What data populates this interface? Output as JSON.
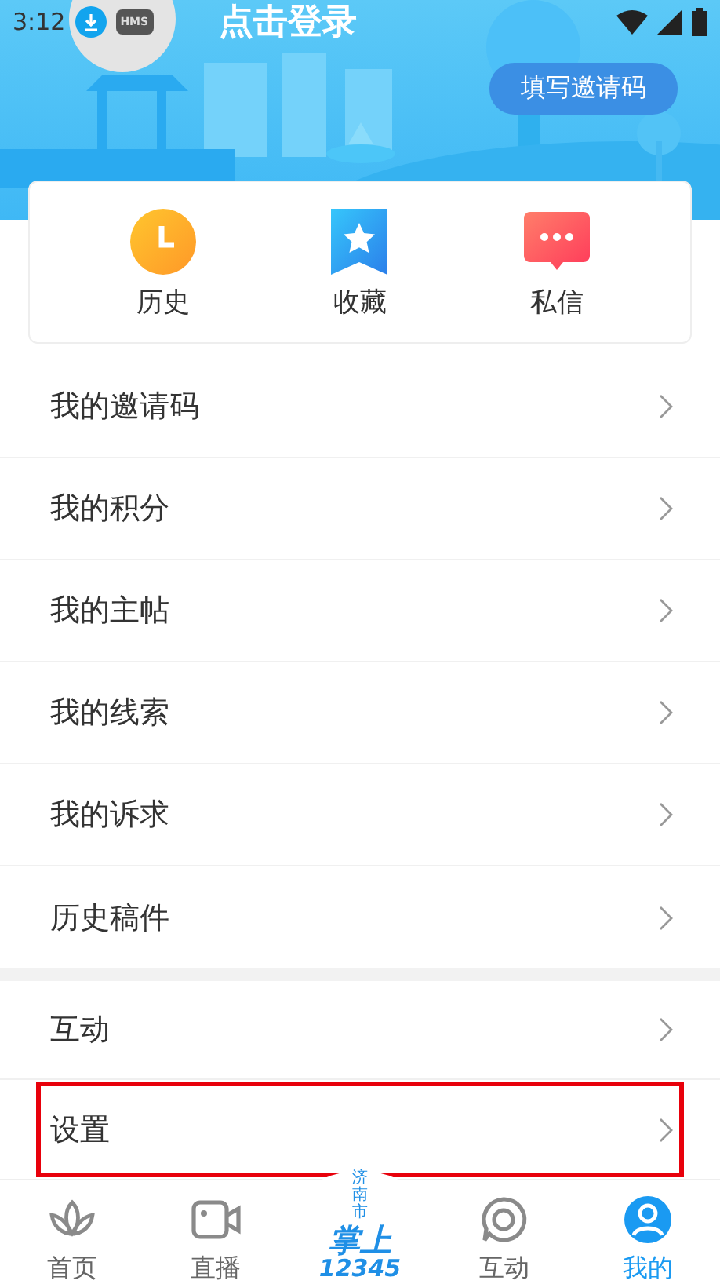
{
  "status_bar": {
    "time": "3:12",
    "badge": "HMS"
  },
  "profile": {
    "login_text": "点击登录",
    "invite_button": "填写邀请码"
  },
  "quick_actions": [
    {
      "kind": "history",
      "label": "历史"
    },
    {
      "kind": "favorites",
      "label": "收藏"
    },
    {
      "kind": "messages",
      "label": "私信"
    }
  ],
  "menu_sections": [
    {
      "items": [
        {
          "label": "我的邀请码",
          "highlighted": false
        },
        {
          "label": "我的积分",
          "highlighted": false
        },
        {
          "label": "我的主帖",
          "highlighted": false
        },
        {
          "label": "我的线索",
          "highlighted": false
        },
        {
          "label": "我的诉求",
          "highlighted": false
        },
        {
          "label": "历史稿件",
          "highlighted": false
        }
      ]
    },
    {
      "items": [
        {
          "label": "互动",
          "highlighted": false
        },
        {
          "label": "设置",
          "highlighted": true
        }
      ]
    }
  ],
  "center_logo": {
    "city": "济南市",
    "title": "掌上",
    "number": "12345"
  },
  "bottom_nav": [
    {
      "kind": "home",
      "label": "首页",
      "selected": false
    },
    {
      "kind": "live",
      "label": "直播",
      "selected": false
    },
    {
      "kind": "interact",
      "label": "互动",
      "selected": false
    },
    {
      "kind": "me",
      "label": "我的",
      "selected": true
    }
  ]
}
